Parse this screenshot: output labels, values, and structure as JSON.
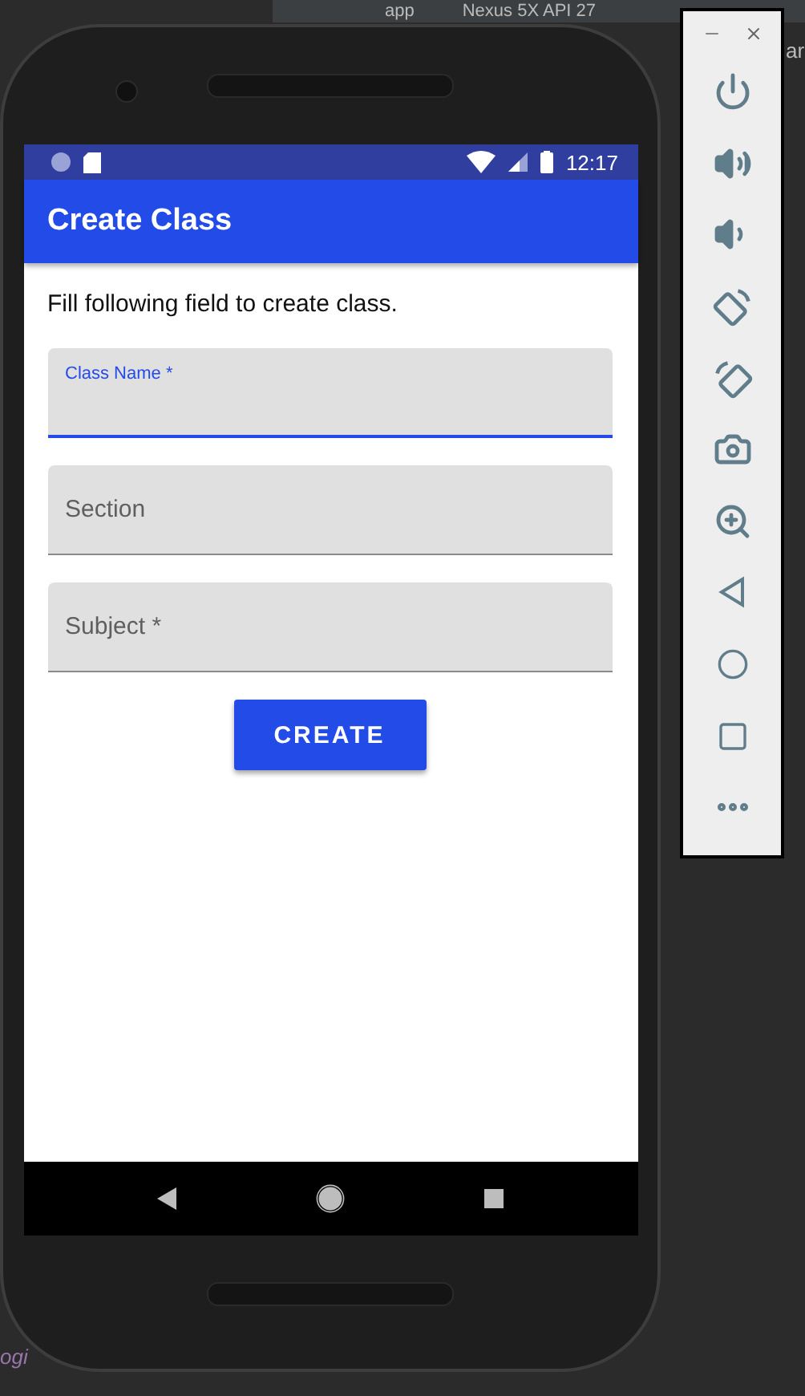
{
  "ide": {
    "tabs": [
      "app",
      "Nexus 5X API 27"
    ],
    "fragments": [
      "ar",
      "ogi"
    ]
  },
  "status_bar": {
    "time": "12:17"
  },
  "app_bar": {
    "title": "Create Class"
  },
  "instruction": "Fill following field to create class.",
  "fields": [
    {
      "label": "Class Name *",
      "focused": true
    },
    {
      "label": "Section",
      "focused": false
    },
    {
      "label": "Subject *",
      "focused": false
    }
  ],
  "button": "CREATE"
}
